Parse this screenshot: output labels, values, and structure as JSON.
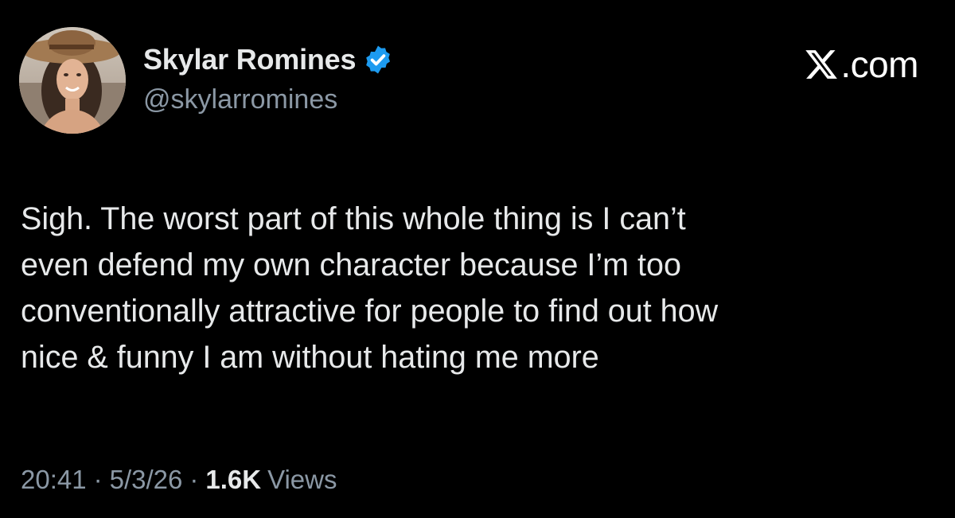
{
  "author": {
    "display_name": "Skylar Romines",
    "handle": "@skylarromines",
    "verified": true,
    "avatar_icon": "profile-photo"
  },
  "brand": {
    "label": ".com",
    "logo_icon": "x-logo-icon"
  },
  "tweet": {
    "text": "Sigh. The worst part of this whole thing is I can’t\neven defend my own character because I’m too\nconventionally attractive for people to find out how\nnice & funny I am without hating me more"
  },
  "meta": {
    "time": "20:41",
    "separator": "·",
    "date": "5/3/26",
    "views_count": "1.6K",
    "views_label": "Views"
  },
  "colors": {
    "background": "#000000",
    "text": "#e7e9ea",
    "secondary": "#8b98a5",
    "verified_badge": "#1d9bf0"
  }
}
